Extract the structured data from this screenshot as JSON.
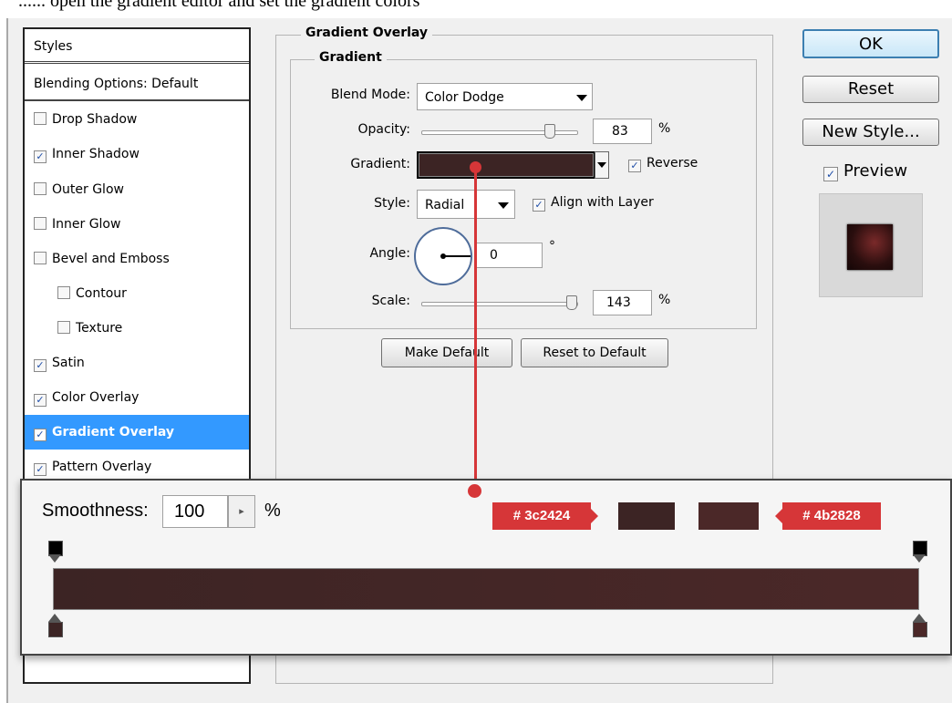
{
  "caption": "...... open the gradient editor and set the gradient colors",
  "styles_panel": {
    "header": "Styles",
    "blending_options": "Blending Options: Default",
    "items": [
      {
        "label": "Drop Shadow",
        "checked": false
      },
      {
        "label": "Inner Shadow",
        "checked": true
      },
      {
        "label": "Outer Glow",
        "checked": false
      },
      {
        "label": "Inner Glow",
        "checked": false
      },
      {
        "label": "Bevel and Emboss",
        "checked": false
      },
      {
        "label": "Contour",
        "checked": false
      },
      {
        "label": "Texture",
        "checked": false
      },
      {
        "label": "Satin",
        "checked": true
      },
      {
        "label": "Color Overlay",
        "checked": true
      },
      {
        "label": "Gradient Overlay",
        "checked": true,
        "selected": true
      },
      {
        "label": "Pattern Overlay",
        "checked": true
      }
    ]
  },
  "gradient_overlay": {
    "title": "Gradient Overlay",
    "subtitle": "Gradient",
    "blend_mode_label": "Blend Mode:",
    "blend_mode_value": "Color Dodge",
    "opacity_label": "Opacity:",
    "opacity_value": "83",
    "opacity_unit": "%",
    "gradient_label": "Gradient:",
    "reverse_label": "Reverse",
    "style_label": "Style:",
    "style_value": "Radial",
    "align_label": "Align with Layer",
    "angle_label": "Angle:",
    "angle_value": "0",
    "angle_unit": "°",
    "scale_label": "Scale:",
    "scale_value": "143",
    "scale_unit": "%",
    "make_default": "Make Default",
    "reset_default": "Reset to Default"
  },
  "right_buttons": {
    "ok": "OK",
    "reset": "Reset",
    "new_style": "New Style...",
    "preview": "Preview"
  },
  "gradient_editor": {
    "smoothness_label": "Smoothness:",
    "smoothness_value": "100",
    "smoothness_unit": "%",
    "left_color_label": "# 3c2424",
    "right_color_label": "# 4b2828"
  },
  "colors": {
    "gradient_start": "#3c2424",
    "gradient_end": "#4b2828",
    "accent_red": "#d63638",
    "selection_blue": "#3399ff"
  }
}
